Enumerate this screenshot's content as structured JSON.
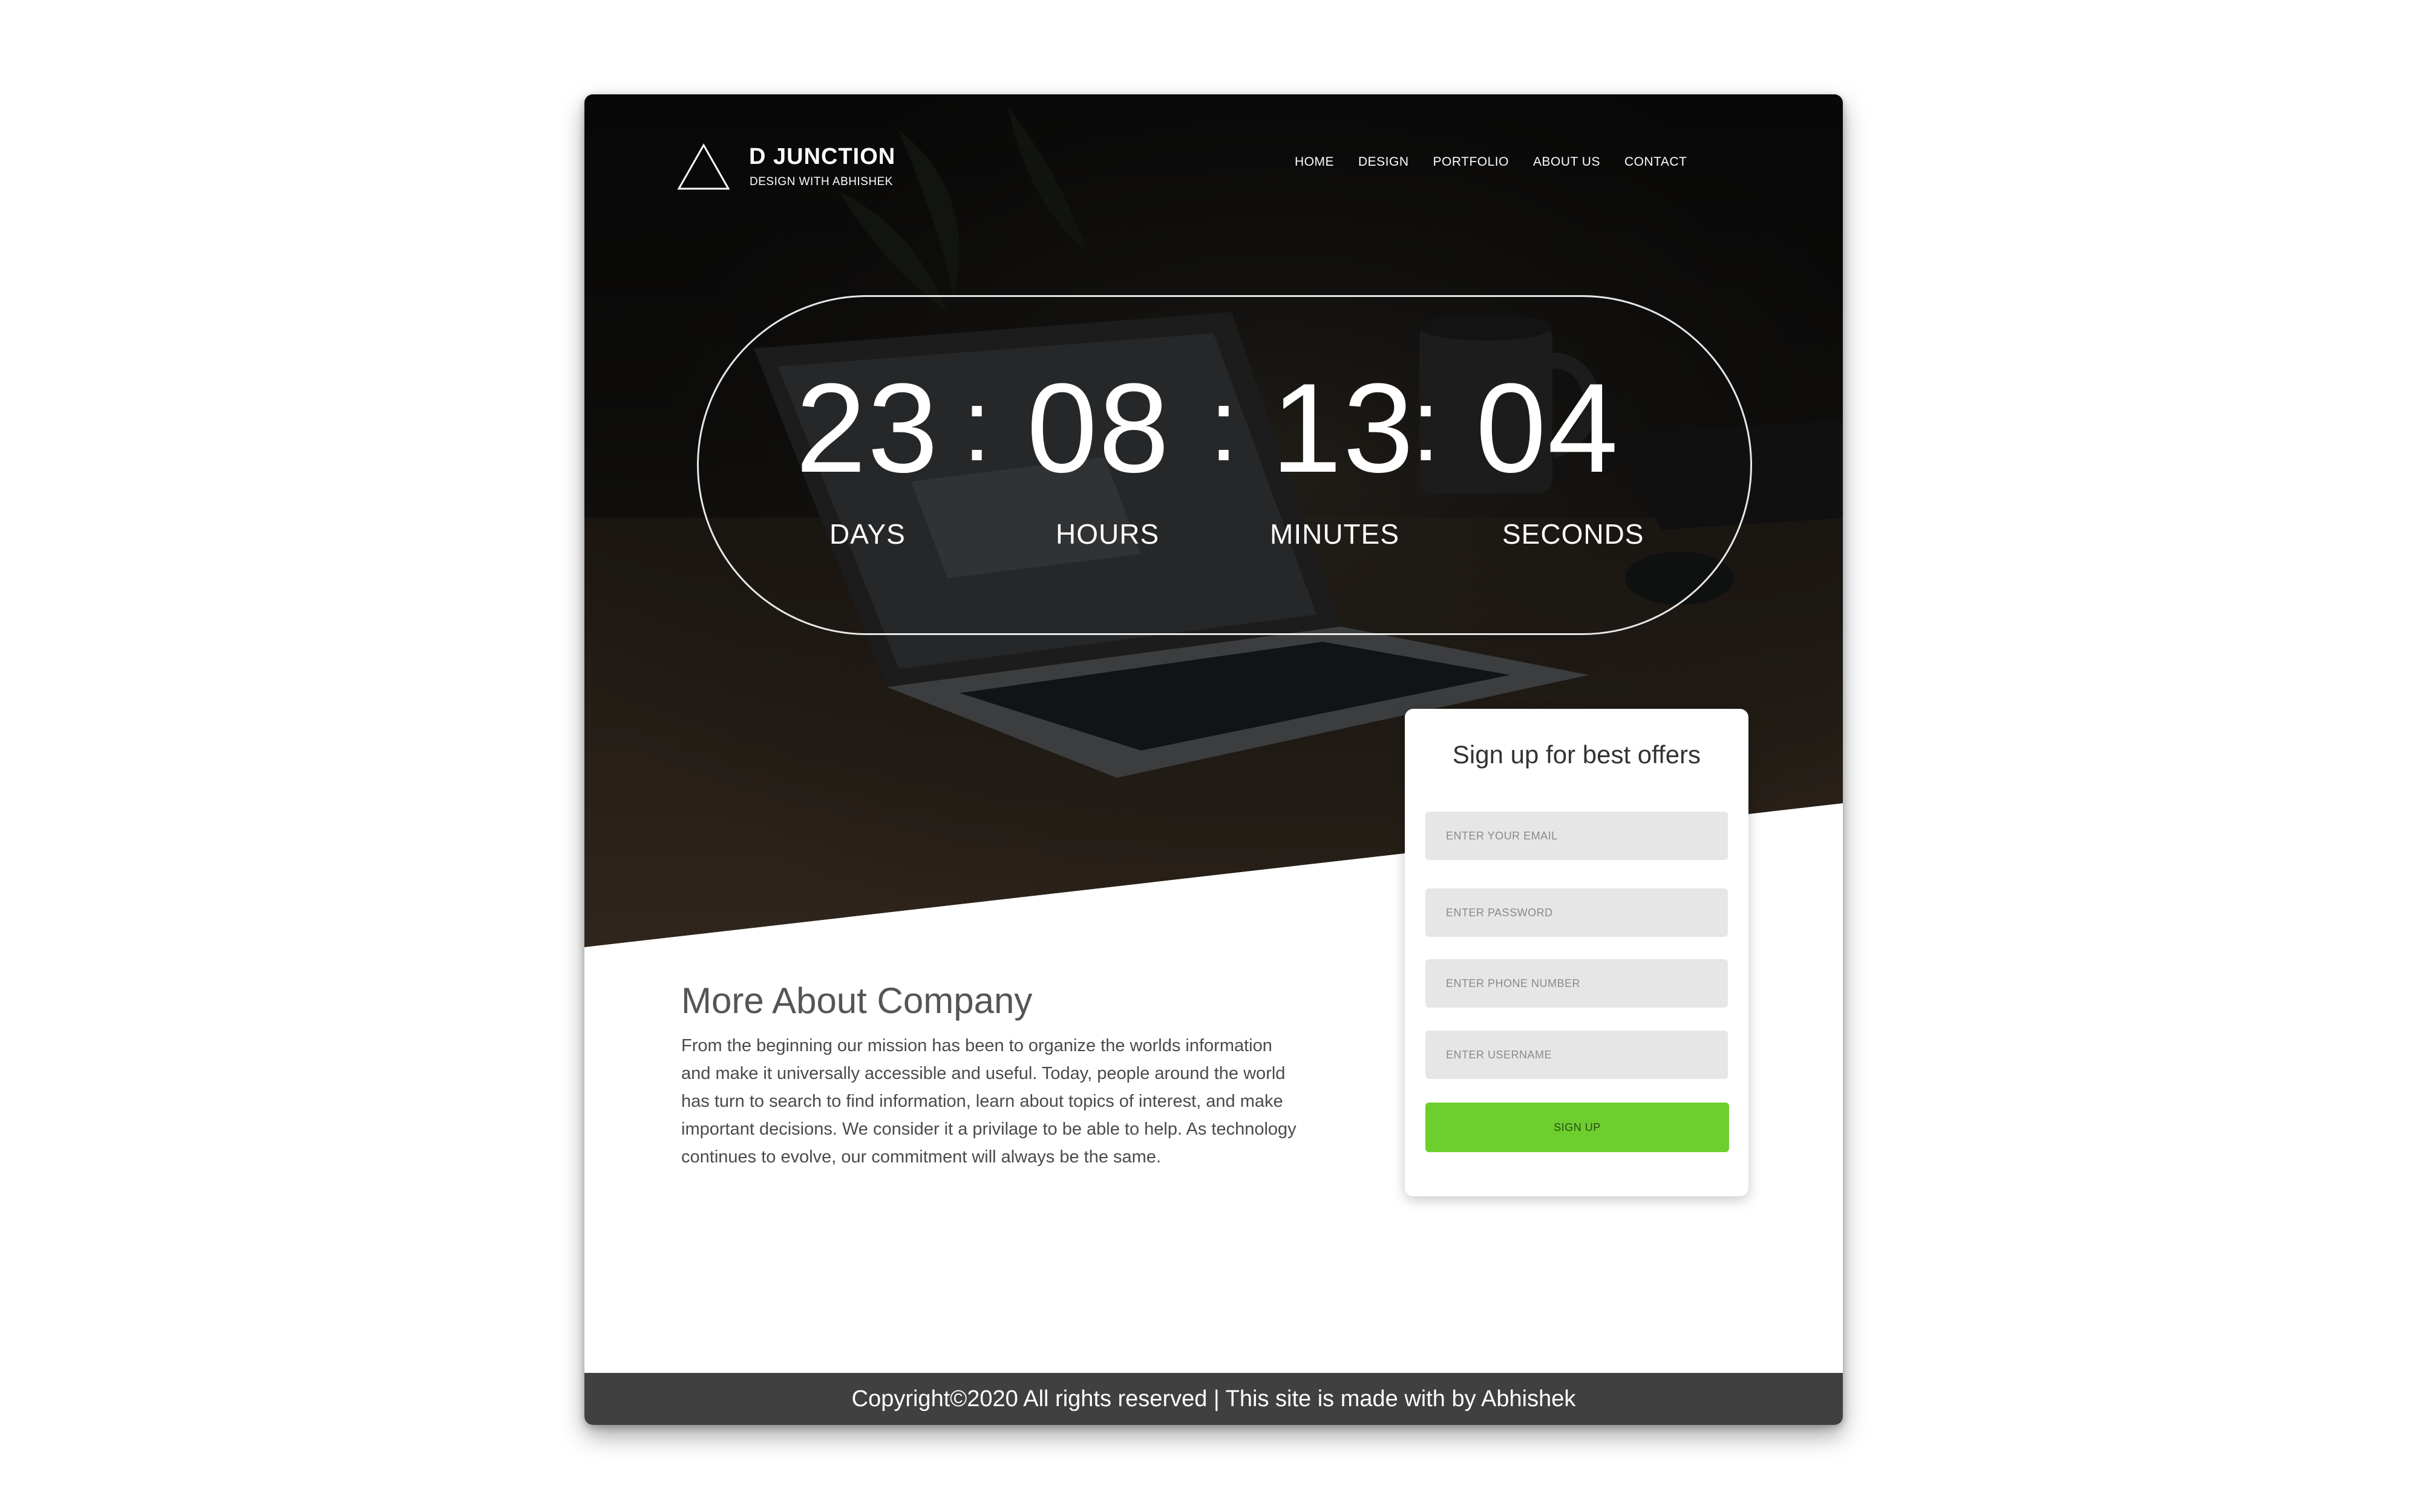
{
  "brand": {
    "name": "D JUNCTION",
    "tagline": "DESIGN WITH ABHISHEK",
    "logo_icon": "triangle-outline-icon"
  },
  "nav": {
    "items": [
      {
        "label": "HOME"
      },
      {
        "label": "DESIGN"
      },
      {
        "label": "PORTFOLIO"
      },
      {
        "label": "ABOUT US"
      },
      {
        "label": "CONTACT"
      }
    ]
  },
  "countdown": {
    "days": "23",
    "hours": "08",
    "minutes": "13",
    "seconds": "04",
    "separator": ":",
    "labels": {
      "days": "DAYS",
      "hours": "HOURS",
      "minutes": "MINUTES",
      "seconds": "SECONDS"
    }
  },
  "about": {
    "title": "More About Company",
    "text": "From the beginning our mission has been to organize the worlds information and make it universally accessible and useful. Today, people around the world has turn to search to find information, learn about topics of interest, and make important decisions. We consider it a privilage to be able to help. As technology continues to evolve, our commitment will always be the same."
  },
  "signup": {
    "title": "Sign up for best offers",
    "email_placeholder": "ENTER YOUR EMAIL",
    "password_placeholder": "ENTER PASSWORD",
    "phone_placeholder": "ENTER PHONE NUMBER",
    "username_placeholder": "ENTER USERNAME",
    "button_label": "SIGN UP"
  },
  "footer": {
    "text": "Copyright©2020 All rights reserved | This site is made with by Abhishek"
  },
  "colors": {
    "accent_green": "#6ccf2e",
    "footer_bg": "#404040",
    "hero_dark": "#141311"
  }
}
